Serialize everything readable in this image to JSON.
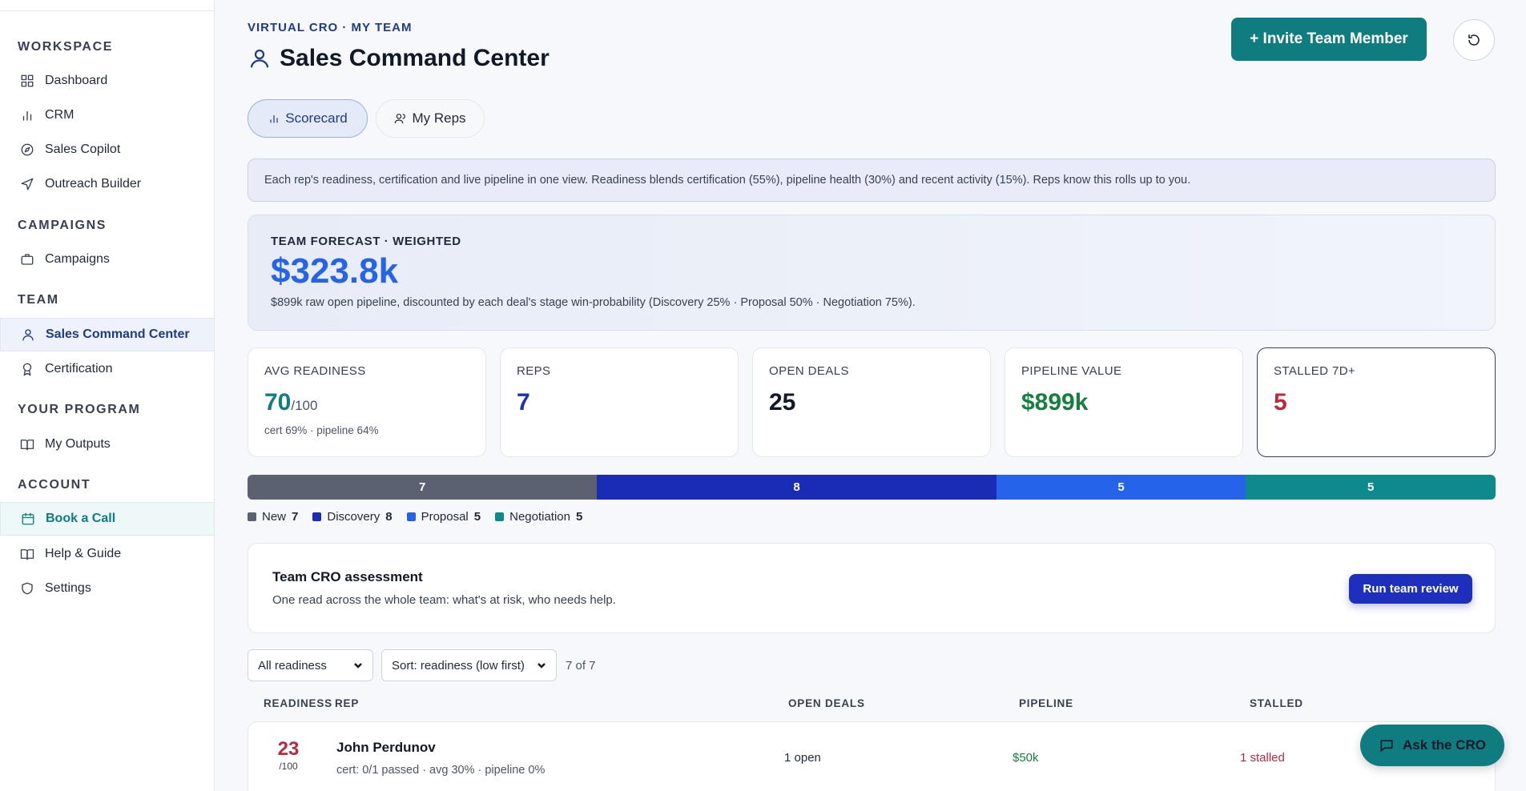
{
  "sidebar": {
    "sections": [
      {
        "title": "WORKSPACE",
        "items": [
          {
            "label": "Dashboard",
            "icon": "grid-icon"
          },
          {
            "label": "CRM",
            "icon": "bar-chart-icon"
          },
          {
            "label": "Sales Copilot",
            "icon": "compass-icon"
          },
          {
            "label": "Outreach Builder",
            "icon": "send-icon"
          }
        ]
      },
      {
        "title": "CAMPAIGNS",
        "items": [
          {
            "label": "Campaigns",
            "icon": "briefcase-icon"
          }
        ]
      },
      {
        "title": "TEAM",
        "items": [
          {
            "label": "Sales Command Center",
            "icon": "user-icon"
          },
          {
            "label": "Certification",
            "icon": "award-icon"
          }
        ]
      },
      {
        "title": "YOUR PROGRAM",
        "items": [
          {
            "label": "My Outputs",
            "icon": "book-icon"
          }
        ]
      },
      {
        "title": "ACCOUNT",
        "items": [
          {
            "label": "Book a Call",
            "icon": "calendar-icon"
          },
          {
            "label": "Help & Guide",
            "icon": "book-open-icon"
          },
          {
            "label": "Settings",
            "icon": "shield-icon"
          }
        ]
      }
    ]
  },
  "header": {
    "breadcrumb": "VIRTUAL CRO · MY TEAM",
    "title": "Sales Command Center",
    "invite_label": "+ Invite Team Member"
  },
  "tabs": [
    {
      "label": "Scorecard",
      "active": true
    },
    {
      "label": "My Reps",
      "active": false
    }
  ],
  "info_banner": "Each rep's readiness, certification and live pipeline in one view. Readiness blends certification (55%), pipeline health (30%) and recent activity (15%). Reps know this rolls up to you.",
  "forecast": {
    "label": "TEAM FORECAST · WEIGHTED",
    "value": "$323.8k",
    "sub": "$899k raw open pipeline, discounted by each deal's stage win-probability (Discovery 25% · Proposal 50% · Negotiation 75%)."
  },
  "stats": [
    {
      "label": "AVG READINESS",
      "value": "70",
      "suffix": "/100",
      "sub": "cert 69% · pipeline 64%",
      "color": "#0f7c80"
    },
    {
      "label": "REPS",
      "value": "7",
      "color": "#1e2fbd"
    },
    {
      "label": "OPEN DEALS",
      "value": "25",
      "color": "#111827"
    },
    {
      "label": "PIPELINE VALUE",
      "value": "$899k",
      "color": "#15803d"
    },
    {
      "label": "STALLED 7D+",
      "value": "5",
      "color": "#c0263d"
    }
  ],
  "stages": [
    {
      "name": "New",
      "count": 7,
      "label": "7",
      "color": "#5b6170"
    },
    {
      "name": "Discovery",
      "count": 8,
      "label": "8",
      "color": "#1a2bb5"
    },
    {
      "name": "Proposal",
      "count": 5,
      "label": "5",
      "color": "#2563eb"
    },
    {
      "name": "Negotiation",
      "count": 5,
      "label": "5",
      "color": "#0f8a8c"
    }
  ],
  "assessment": {
    "title": "Team CRO assessment",
    "sub": "One read across the whole team: what's at risk, who needs help.",
    "button": "Run team review"
  },
  "filters": {
    "readiness": "All readiness",
    "sort": "Sort: readiness (low first)",
    "count": "7 of 7"
  },
  "table": {
    "headers": [
      "READINESS",
      "REP",
      "OPEN DEALS",
      "PIPELINE",
      "STALLED"
    ],
    "rows": [
      {
        "score": "23",
        "score_den": "/100",
        "name": "John Perdunov",
        "meta": "cert: 0/1 passed · avg 30% · pipeline 0%",
        "open": "1 open",
        "pipeline": "$50k",
        "stalled": "1 stalled"
      }
    ]
  },
  "ask_button": "Ask the CRO"
}
